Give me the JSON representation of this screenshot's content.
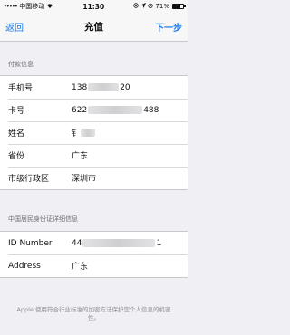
{
  "status_bar": {
    "signal": "•••••",
    "carrier": "中国移动",
    "time": "11:30",
    "battery_percent": "71%",
    "battery_level": 0.71
  },
  "nav": {
    "back_label": "返回",
    "title": "充值",
    "next_label": "下一步"
  },
  "payment_section": {
    "header": "付款信息",
    "rows": [
      {
        "label": "手机号",
        "value_prefix": "138",
        "value_suffix": "20"
      },
      {
        "label": "卡号",
        "value_prefix": "622",
        "value_suffix": "488"
      },
      {
        "label": "姓名",
        "value_prefix": "钅",
        "value_suffix": ""
      },
      {
        "label": "省份",
        "value": "广东"
      },
      {
        "label": "市级行政区",
        "value": "深圳市"
      }
    ]
  },
  "id_section": {
    "header": "中国居民身份证详细信息",
    "rows": [
      {
        "label": "ID Number",
        "value_prefix": "44",
        "value_suffix": "1"
      },
      {
        "label": "Address",
        "value": "广东"
      }
    ]
  },
  "footer_note": "Apple 使用符合行业标准的加密方法保护您个人信息的机密性。"
}
